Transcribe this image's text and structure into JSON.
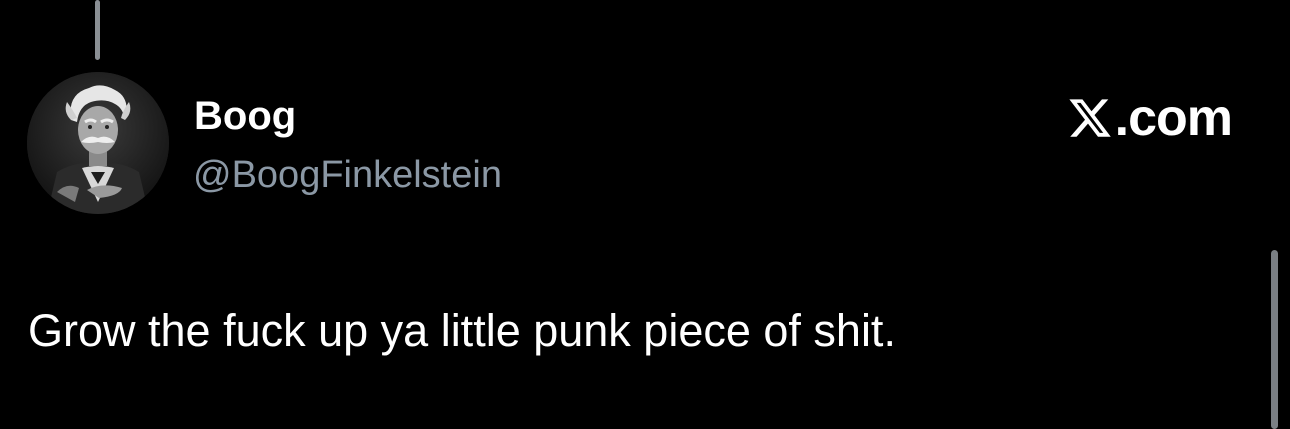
{
  "tweet": {
    "author": {
      "display_name": "Boog",
      "handle": "@BoogFinkelstein",
      "avatar_icon": "avatar-portrait-icon"
    },
    "brand_label": ".com",
    "brand_icon": "x-logo-icon",
    "text": "Grow the fuck up ya little punk piece of shit."
  },
  "colors": {
    "background": "#000000",
    "primary_text": "#ffffff",
    "secondary_text": "#8b98a5",
    "thread_line": "#8a8f94"
  }
}
